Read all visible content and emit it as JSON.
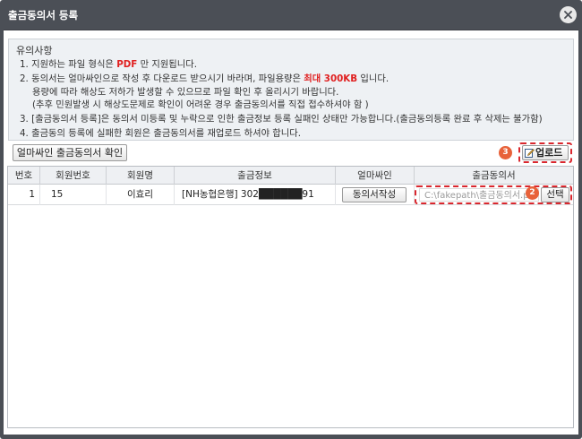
{
  "window": {
    "title": "출금동의서 등록",
    "close_icon": "close-icon"
  },
  "notice": {
    "heading": "유의사항",
    "line1_prefix": "1. 지원하는 파일 형식은 ",
    "line1_highlight": "PDF",
    "line1_suffix": " 만 지원됩니다.",
    "line2_prefix": "2. 동의서는 얼마싸인으로 작성 후 다운로드 받으시기 바라며, 파일용량은 ",
    "line2_highlight": "최대 300KB",
    "line2_suffix": " 입니다.",
    "line2b": "용량에 따라 해상도 저하가 발생할 수 있으므로 파일 확인 후 올리시기 바랍니다.",
    "line2c": "(추후 민원발생 시 해상도문제로 확인이 어려운 경우 출금동의서를 직접 접수하셔야 함 )",
    "line3": "3. [출금동의서 등록]은 동의서 미등록 및 누락으로 인한 출금정보 등록 실패인 상태만 가능합니다.(출금동의등록 완료 후 삭제는 불가함)",
    "line4": "4. 출금동의 등록에 실패한 회원은 출금동의서를 재업로드 하셔야 합니다.",
    "highlight_color": "#e02020"
  },
  "toolbar": {
    "confirm_label": "얼마싸인 출금동의서 확인",
    "upload_label": "업로드",
    "upload_icon": "edit-icon",
    "step3": "3",
    "step2": "2"
  },
  "table": {
    "headers": [
      "번호",
      "회원번호",
      "회원명",
      "출금정보",
      "얼마싸인",
      "출금동의서"
    ],
    "rows": [
      {
        "no": "1",
        "member_no": "15",
        "member_name": "이효리",
        "account": "[NH농협은행] 302██████91",
        "write_label": "동의서작성",
        "file_value": "C:\\fakepath\\출금동의서.pdf",
        "select_label": "선택"
      }
    ]
  },
  "colors": {
    "titlebar": "#4b4f56",
    "notice_bg": "#eef1f4",
    "accent_red": "#d9272e",
    "step_badge": "#e8623a"
  }
}
